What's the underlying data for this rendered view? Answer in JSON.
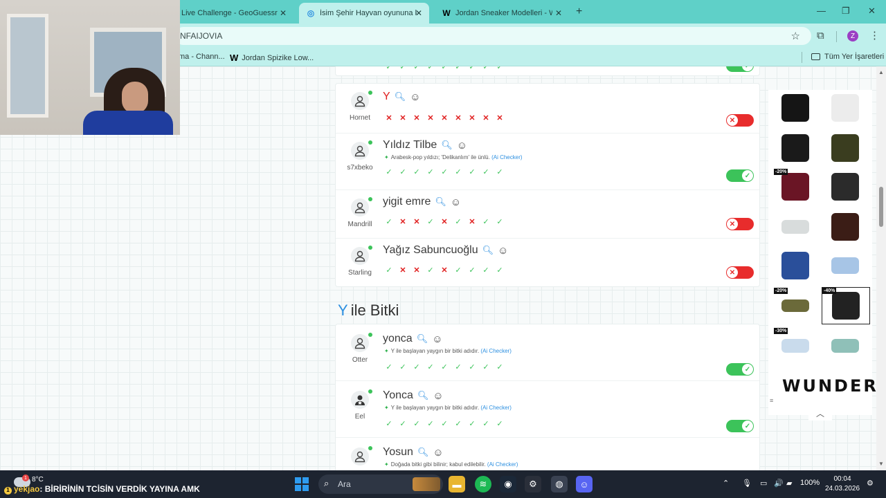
{
  "browser": {
    "tabs": [
      {
        "label": "Live Challenge - GeoGuessr",
        "active": false
      },
      {
        "label": "İsim Şehir Hayvan oyununa katı",
        "active": true
      },
      {
        "label": "Jordan Sneaker Modelleri - WU",
        "active": false
      }
    ],
    "url": "NFAIJOVIA",
    "bookmarks": [
      "ma - Chann...",
      "Jordan Spizike Low..."
    ],
    "all_bookmarks": "Tüm Yer İşaretleri",
    "profile_initial": "Z"
  },
  "game": {
    "prev_rows": [
      {
        "user": "Hornet",
        "answer": "Y",
        "answer_red": true,
        "note": "",
        "votes": [
          "no",
          "no",
          "no",
          "no",
          "no",
          "no",
          "no",
          "no",
          "no"
        ],
        "accepted": false
      },
      {
        "user": "s7xbeko",
        "answer": "Yıldız Tilbe",
        "note": "Arabesk-pop yıldızı; 'Delikanlım' ile ünlü.",
        "ai": "(Ai Checker)",
        "votes": [
          "ok",
          "ok",
          "ok",
          "ok",
          "ok",
          "ok",
          "ok",
          "ok",
          "ok"
        ],
        "accepted": true
      },
      {
        "user": "Mandrill",
        "answer": "yigit emre",
        "note": "",
        "votes": [
          "ok",
          "no",
          "no",
          "ok",
          "no",
          "ok",
          "no",
          "ok",
          "ok"
        ],
        "accepted": false
      },
      {
        "user": "Starling",
        "answer": "Yağız Sabuncuoğlu",
        "note": "",
        "votes": [
          "ok",
          "no",
          "no",
          "ok",
          "no",
          "ok",
          "ok",
          "ok",
          "ok"
        ],
        "accepted": false
      }
    ],
    "section": {
      "letter": "Y",
      "title": "ile Bitki"
    },
    "rows": [
      {
        "user": "Otter",
        "answer": "yonca",
        "note": "Y ile başlayan yaygın bir bitki adıdır.",
        "ai": "(Ai Checker)",
        "votes": [
          "ok",
          "ok",
          "ok",
          "ok",
          "ok",
          "ok",
          "ok",
          "ok",
          "ok"
        ],
        "accepted": true,
        "avatar": "person"
      },
      {
        "user": "Eel",
        "answer": "Yonca",
        "note": "Y ile başlayan yaygın bir bitki adıdır.",
        "ai": "(Ai Checker)",
        "votes": [
          "ok",
          "ok",
          "ok",
          "ok",
          "ok",
          "ok",
          "ok",
          "ok",
          "ok"
        ],
        "accepted": true,
        "avatar": "star"
      },
      {
        "user": "",
        "answer": "Yosun",
        "note": "Doğada bitki gibi bilinir; kabul edilebilir.",
        "ai": "(Ai Checker)",
        "votes": [],
        "accepted": null,
        "avatar": "person"
      }
    ]
  },
  "ad": {
    "brand": "WUNDER",
    "discounts": [
      "-20%",
      "-20%",
      "-40%",
      "-30%"
    ],
    "colors": {
      "accent": "#111111"
    }
  },
  "taskbar": {
    "weather_temp": "8°C",
    "weather_badge": "1",
    "ticker_user": "yekjao",
    "ticker_text": "BİRİRİNİN TCİSİN VERDİK YAYINA AMK",
    "search_label": "Ara",
    "battery": "100%",
    "time": "00:04",
    "date": "24.03.2026"
  },
  "colors": {
    "tabbar": "#5fd0c8",
    "toolbar": "#bff0ec",
    "ok": "#3cc35a",
    "no": "#e02020",
    "link": "#2c8fe0"
  }
}
